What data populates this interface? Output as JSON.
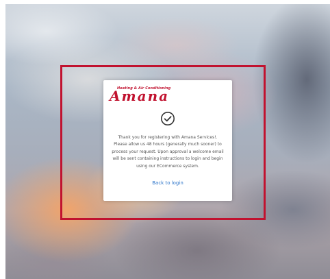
{
  "brand": {
    "tagline": "Heating & Air Conditioning",
    "name": "Amana",
    "color": "#c1122f"
  },
  "status": {
    "icon": "check-circle-icon"
  },
  "message": "Thank you for registering with Amana Services!. Please allow us 48 hours (generally much sooner) to process your request. Upon approval a welcome email will be sent containing instructions to login and begin using our ECommerce system.",
  "back_link": {
    "label": "Back to login",
    "color": "#2a73c9"
  },
  "highlight": {
    "color": "#c1122f"
  }
}
